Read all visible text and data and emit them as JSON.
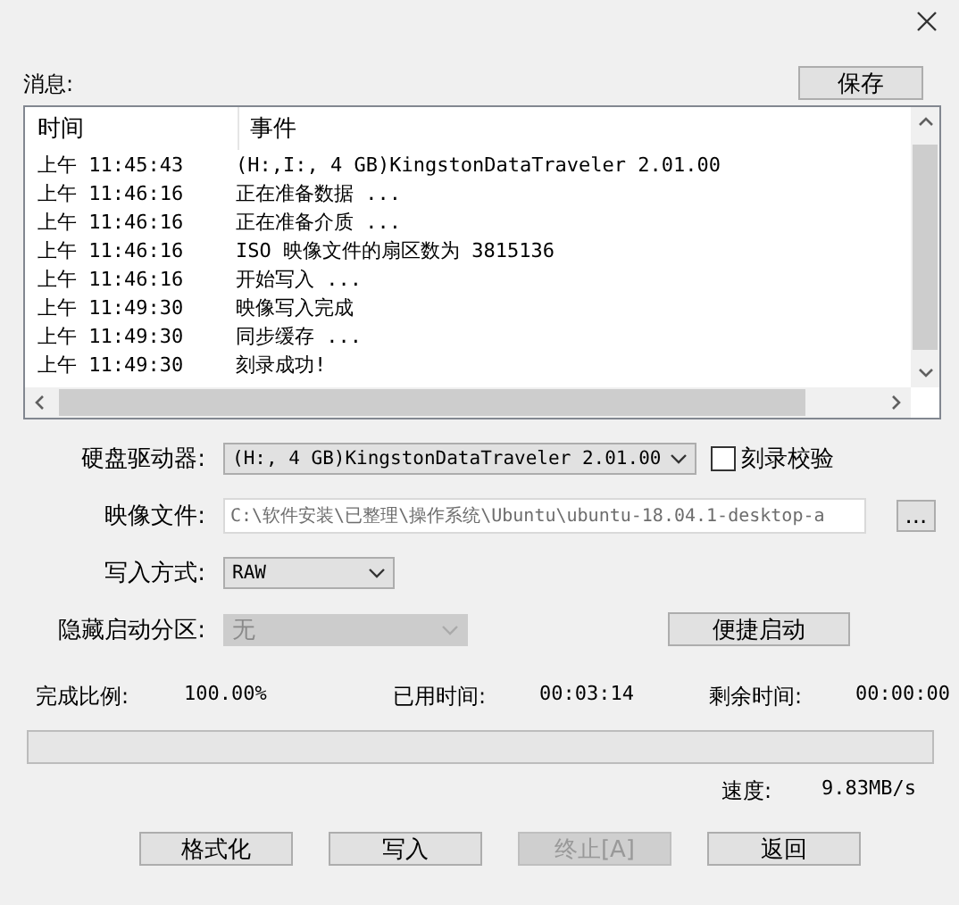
{
  "messages": {
    "label": "消息:",
    "save_button": "保存",
    "columns": [
      "时间",
      "事件"
    ],
    "rows": [
      {
        "time": "上午 11:45:43",
        "event": "(H:,I:, 4 GB)KingstonDataTraveler 2.01.00"
      },
      {
        "time": "上午 11:46:16",
        "event": "正在准备数据 ..."
      },
      {
        "time": "上午 11:46:16",
        "event": "正在准备介质 ..."
      },
      {
        "time": "上午 11:46:16",
        "event": "ISO 映像文件的扇区数为 3815136"
      },
      {
        "time": "上午 11:46:16",
        "event": "开始写入 ..."
      },
      {
        "time": "上午 11:49:30",
        "event": "映像写入完成"
      },
      {
        "time": "上午 11:49:30",
        "event": "同步缓存 ..."
      },
      {
        "time": "上午 11:49:30",
        "event": "刻录成功!"
      }
    ]
  },
  "drive": {
    "label": "硬盘驱动器:",
    "value": "(H:, 4 GB)KingstonDataTraveler 2.01.00"
  },
  "verify": {
    "label": "刻录校验",
    "checked": false
  },
  "image_file": {
    "label": "映像文件:",
    "value": "C:\\软件安装\\已整理\\操作系统\\Ubuntu\\ubuntu-18.04.1-desktop-a",
    "browse": "..."
  },
  "write_mode": {
    "label": "写入方式:",
    "value": "RAW"
  },
  "hidden_partition": {
    "label": "隐藏启动分区:",
    "value": "无",
    "disabled": true
  },
  "quick_boot": "便捷启动",
  "stats": [
    {
      "label": "完成比例:",
      "value": "100.00%"
    },
    {
      "label": "已用时间:",
      "value": "00:03:14"
    },
    {
      "label": "剩余时间:",
      "value": "00:00:00"
    }
  ],
  "progress": {
    "level": 1
  },
  "speed": {
    "label": "速度:",
    "value": "9.83MB/s"
  },
  "buttons": [
    {
      "label": "格式化",
      "disabled": false
    },
    {
      "label": "写入",
      "disabled": false
    },
    {
      "label": "终止[A]",
      "disabled": true
    },
    {
      "label": "返回",
      "disabled": false
    }
  ]
}
